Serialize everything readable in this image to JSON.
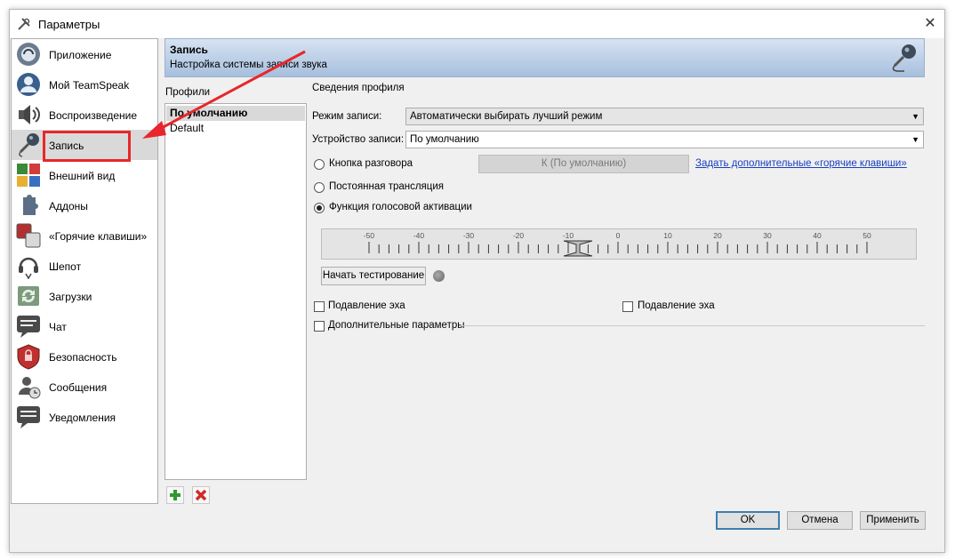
{
  "window": {
    "title": "Параметры",
    "close_label": "✕"
  },
  "sidebar": {
    "items": [
      {
        "label": "Приложение",
        "icon": "application-icon"
      },
      {
        "label": "Мой TeamSpeak",
        "icon": "user-icon"
      },
      {
        "label": "Воспроизведение",
        "icon": "speaker-icon"
      },
      {
        "label": "Запись",
        "icon": "microphone-icon",
        "active": true
      },
      {
        "label": "Внешний вид",
        "icon": "appearance-icon"
      },
      {
        "label": "Аддоны",
        "icon": "puzzle-icon"
      },
      {
        "label": "«Горячие клавиши»",
        "icon": "hotkeys-icon"
      },
      {
        "label": "Шепот",
        "icon": "headset-icon"
      },
      {
        "label": "Загрузки",
        "icon": "downloads-icon"
      },
      {
        "label": "Чат",
        "icon": "chat-icon"
      },
      {
        "label": "Безопасность",
        "icon": "shield-icon"
      },
      {
        "label": "Сообщения",
        "icon": "messages-icon"
      },
      {
        "label": "Уведомления",
        "icon": "notifications-icon"
      }
    ]
  },
  "header": {
    "title": "Запись",
    "subtitle": "Настройка системы записи звука"
  },
  "profiles": {
    "label": "Профили",
    "items": [
      {
        "label": "По умолчанию",
        "selected": true
      },
      {
        "label": "Default",
        "selected": false
      }
    ]
  },
  "settings": {
    "group_label": "Сведения профиля",
    "mode_label": "Режим записи:",
    "mode_value": "Автоматически выбирать лучший режим",
    "device_label": "Устройство записи:",
    "device_value": "По умолчанию",
    "radio_ptt": "Кнопка разговора",
    "radio_continuous": "Постоянная трансляция",
    "radio_vad": "Функция голосовой активации",
    "key_button": "К (По умолчанию)",
    "hotkeys_link": "Задать дополнительные «горячие клавиши»",
    "meter_ticks": [
      "-50",
      "-40",
      "-30",
      "-20",
      "-10",
      "0",
      "10",
      "20",
      "30",
      "40",
      "50"
    ],
    "meter_threshold": -10,
    "test_button": "Начать тестирование",
    "echo1": "Подавление эха",
    "echo2": "Подавление эха",
    "advanced": "Дополнительные параметры"
  },
  "buttons": {
    "ok": "OK",
    "cancel": "Отмена",
    "apply": "Применить"
  },
  "colors": {
    "highlight": "#e8262b",
    "header_top": "#d6e3f2",
    "header_bottom": "#a7bfdd",
    "link": "#1a3fbf"
  }
}
